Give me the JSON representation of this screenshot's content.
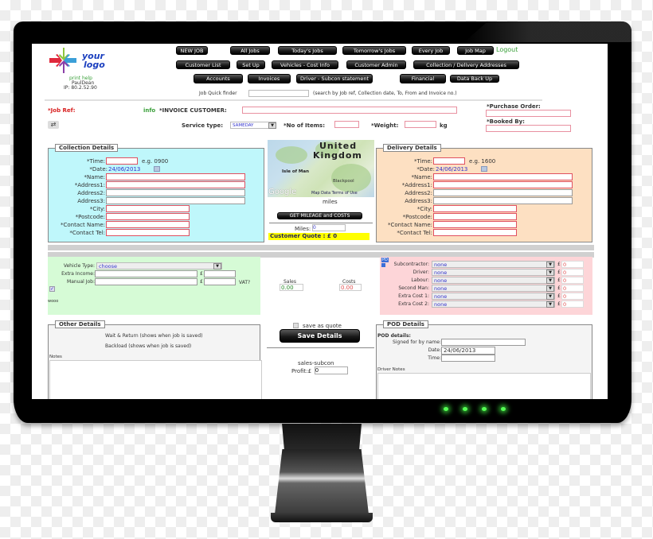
{
  "logo": {
    "line1": "your",
    "line2": "logo"
  },
  "user": {
    "help_label": "print help",
    "name": "PaulDean",
    "ip": "IP: 80.2.52.90"
  },
  "nav": {
    "row1": [
      "NEW JOB",
      "All Jobs",
      "Today's Jobs",
      "Tomorrow's Jobs",
      "Every Job",
      "Job Map"
    ],
    "logout": "Logout",
    "row2": [
      "Customer List",
      "Set Up",
      "Vehicles - Cost Info",
      "Customer Admin",
      "Collection / Delivery Addresses"
    ],
    "row3": [
      "Accounts",
      "Invoices",
      "Driver - Subcon statement",
      "Financial",
      "Data Back Up"
    ]
  },
  "finder": {
    "label": "Job Quick finder",
    "value": "",
    "hint": "(search by Job ref, Collection date, To, From and Invoice no.)"
  },
  "header": {
    "job_ref_label": "*Job Ref:",
    "info_link": "info",
    "invoice_customer_label": "*INVOICE CUSTOMER:",
    "invoice_customer_value": "",
    "purchase_order_label": "*Purchase Order:",
    "purchase_order_value": "",
    "booked_by_label": "*Booked By:",
    "booked_by_value": "",
    "service_type_label": "Service type:",
    "service_type_value": "SAMEDAY",
    "items_label": "*No of Items:",
    "items_value": "",
    "weight_label": "*Weight:",
    "weight_value": "",
    "weight_unit": "kg"
  },
  "collection": {
    "title": "Collection Details",
    "time_label": "*Time:",
    "time_value": "",
    "time_hint": "e.g. 0900",
    "date_label": "*Date:",
    "date_value": "24/06/2013",
    "name_label": "*Name:",
    "address1_label": "*Address1:",
    "address2_label": "Address2:",
    "address3_label": "Address3:",
    "city_label": "*City:",
    "postcode_label": "*Postcode:",
    "contact_name_label": "*Contact Name:",
    "contact_tel_label": "*Contact Tel:"
  },
  "delivery": {
    "title": "Delivery Details",
    "time_label": "*Time:",
    "time_value": "",
    "time_hint": "e.g. 1600",
    "date_label": "*Date:",
    "date_value": "24/06/2013",
    "name_label": "*Name:",
    "address1_label": "*Address1:",
    "address2_label": "Address2:",
    "address3_label": "Address3:",
    "city_label": "*City:",
    "postcode_label": "*Postcode:",
    "contact_name_label": "*Contact Name:",
    "contact_tel_label": "*Contact Tel:"
  },
  "map": {
    "country": [
      "United",
      "Kingdom"
    ],
    "places": [
      "Isle of Man",
      "Blackpool"
    ],
    "brand": "Google",
    "attribution": "Map Data  Terms of Use",
    "units": "miles",
    "mileage_button": "GET MILEAGE and COSTS",
    "miles_label": "Miles:",
    "miles_value": "0",
    "quote_label": "Customer Quote : £ 0"
  },
  "vehicle": {
    "type_label": "Vehicle Type:",
    "type_value": "choose",
    "extra_income_label": "Extra Income:",
    "manual_job_label": "Manual Job:",
    "currency": "£",
    "vat_label": "VAT?",
    "woo_label": "wooo"
  },
  "totals": {
    "sales_label": "Sales",
    "sales_value": "0.00",
    "costs_label": "Costs",
    "costs_value": "0.00"
  },
  "costs": {
    "badge": "PD",
    "rows": [
      {
        "label": "Subcontractor:",
        "value": "none",
        "amount": "0"
      },
      {
        "label": "Driver:",
        "value": "none",
        "amount": "0"
      },
      {
        "label": "Labour:",
        "value": "none",
        "amount": "0"
      },
      {
        "label": "Second Man:",
        "value": "none",
        "amount": "0"
      },
      {
        "label": "Extra Cost 1:",
        "value": "none",
        "amount": "0"
      },
      {
        "label": "Extra Cost 2:",
        "value": "none",
        "amount": "0"
      }
    ],
    "currency": "£"
  },
  "other": {
    "title": "Other Details",
    "wait_return": "Wait & Return (shows when job is saved)",
    "backload": "Backload (shows when job is saved)",
    "notes_label": "Notes"
  },
  "save": {
    "quote_label": "save as quote",
    "button": "Save Details",
    "sales_subcon": "sales-subcon",
    "profit_label": "Profit:£",
    "profit_value": "0"
  },
  "pod": {
    "title": "POD Details",
    "heading": "POD details:",
    "signed_label": "Signed for by name:",
    "date_label": "Date:",
    "date_value": "24/06/2013",
    "time_label": "Time:",
    "driver_notes_label": "Driver Notes"
  },
  "colors": {
    "collection_bg": "#bff7fb",
    "delivery_bg": "#fde0c2",
    "vehicle_bg": "#d6fbd6",
    "costs_bg": "#fdd5d8",
    "quote_bg": "#ffff00",
    "required_border": "#e05060"
  }
}
